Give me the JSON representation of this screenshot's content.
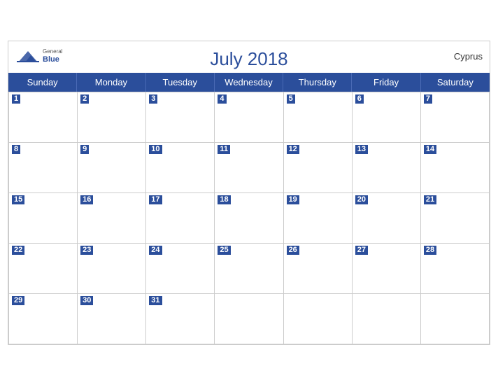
{
  "calendar": {
    "title": "July 2018",
    "country": "Cyprus",
    "brand": {
      "general": "General",
      "blue": "Blue"
    },
    "day_names": [
      "Sunday",
      "Monday",
      "Tuesday",
      "Wednesday",
      "Thursday",
      "Friday",
      "Saturday"
    ],
    "weeks": [
      [
        1,
        2,
        3,
        4,
        5,
        6,
        7
      ],
      [
        8,
        9,
        10,
        11,
        12,
        13,
        14
      ],
      [
        15,
        16,
        17,
        18,
        19,
        20,
        21
      ],
      [
        22,
        23,
        24,
        25,
        26,
        27,
        28
      ],
      [
        29,
        30,
        31,
        null,
        null,
        null,
        null
      ]
    ]
  }
}
